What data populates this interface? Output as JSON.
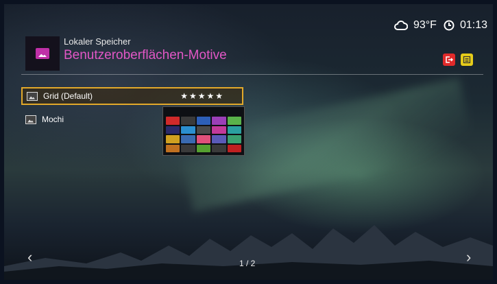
{
  "header": {
    "subtitle": "Lokaler Speicher",
    "title": "Benutzeroberflächen-Motive",
    "icon": "picture-icon"
  },
  "status": {
    "weather_icon": "cloud-icon",
    "temperature": "93°F",
    "clock_icon": "clock-icon",
    "time": "01:13"
  },
  "buttons": {
    "red": {
      "icon": "exit-icon",
      "color": "#e02a2a"
    },
    "yellow": {
      "icon": "menu-icon",
      "color": "#e6cc1a"
    }
  },
  "list": {
    "items": [
      {
        "label": "Grid (Default)",
        "rating": "★★★★★",
        "selected": true
      },
      {
        "label": "Mochi",
        "selected": false
      }
    ]
  },
  "pager": {
    "text": "1 / 2"
  },
  "colors": {
    "accent": "#e257c6",
    "selection": "#e3a92a"
  }
}
